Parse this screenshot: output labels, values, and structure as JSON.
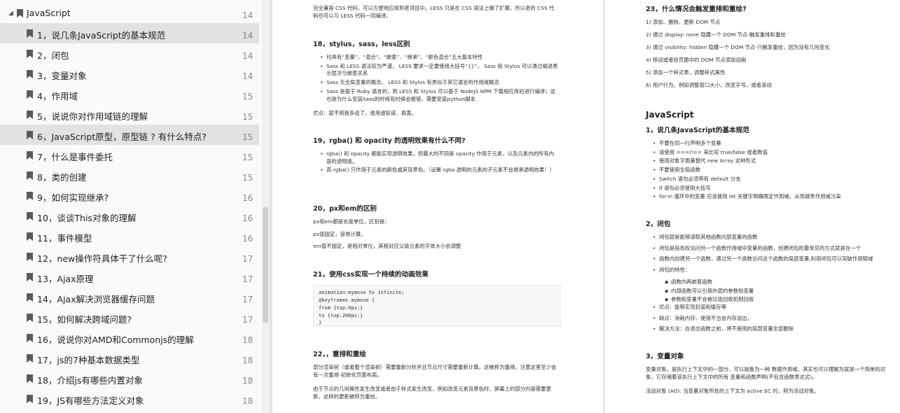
{
  "sidebar": {
    "title": "JavaScript",
    "title_page": "14",
    "items": [
      {
        "label": "1，说几条JavaScript的基本规范",
        "page": "14"
      },
      {
        "label": "2，闭包",
        "page": "14"
      },
      {
        "label": "3，变量对象",
        "page": "14"
      },
      {
        "label": "4，作用域",
        "page": "15"
      },
      {
        "label": "5，说说你对作用域链的理解",
        "page": "15"
      },
      {
        "label": "6，JavaScript原型，原型链 ? 有什么特点?",
        "page": "15"
      },
      {
        "label": "7，什么是事件委托",
        "page": "15"
      },
      {
        "label": "8，类的创建",
        "page": "15"
      },
      {
        "label": "9，如何实现继承?",
        "page": "16"
      },
      {
        "label": "10，谈谈This对象的理解",
        "page": "16"
      },
      {
        "label": "11，事件模型",
        "page": "16"
      },
      {
        "label": "12，new操作符具体干了什么呢?",
        "page": "17"
      },
      {
        "label": "13，Ajax原理",
        "page": "17"
      },
      {
        "label": "14，Ajax解决浏览器缓存问题",
        "page": "17"
      },
      {
        "label": "15，如何解决跨域问题?",
        "page": "17"
      },
      {
        "label": "16，说说你对AMD和Commonjs的理解",
        "page": "18"
      },
      {
        "label": "17，js的7种基本数据类型",
        "page": "18"
      },
      {
        "label": "18，介绍js有哪些内置对象",
        "page": "18"
      },
      {
        "label": "19，JS有哪些方法定义对象",
        "page": "18"
      }
    ]
  },
  "page1": {
    "intro_l1": "完全兼容 CSS 代码，可以方便地应用到老项目中。LESS 只是在 CSS 语法上做了扩展，所以老的 CSS 代",
    "intro_l2": "码也可以与 LESS 代码一同编译。",
    "s18_title": "18，stylus，sass，less区别",
    "s18_bullets": [
      "均具有“变量”、“混合”、“嵌套”、“继承”、“颜色混合”五大基本特性",
      "Sass 和 LESS 语法较为严谨， LESS 要求一定要使用大括号“{}”， Sass 和 Stylus 可以通过缩进表示层次与嵌套关系",
      "Sass 无全局变量的概念， LESS 和 Stylus 有类似于其它语言的作用域概念",
      "Sass 是基于 Ruby 语言的，而 LESS 和 Stylus 可以基于 NodeJS NPM 下载相应库后进行编译；这也是为什么安装Sass的时候有时候会报错，需要安装python脚本"
    ],
    "s18_note": "优点：就不用我多说了，谁用谁知道，真香。",
    "s19_title": "19，rgba() 和 opacity 的透明效果有什么不同?",
    "s19_bullets": [
      "rgba() 和 opacity 都能实现透明效果，但最大的不同是 opacity 作用于元素，以及元素内的所有内容的透明度。",
      "而 rgba() 只作用于元素的颜色或其背景色。（设置 rgba 透明的元素的子元素不会继承透明效果！）"
    ],
    "s20_title": "20，px和em的区别",
    "s20_lines": [
      "px和em都是长度单位，区别是：",
      "px值固定，容易计算。",
      "em值不固定，是相对单位，其相对应父级元素的字体大小会调整"
    ],
    "s21_title": "21，使用css实现一个持续的动画效果",
    "s21_code": "animation:mymove 5s infinite;\n@keyframes mymove {\nfrom {top:0px;}\nto {top:200px;}\n}",
    "s22_title": "22，，重排和重绘",
    "s22_p1": "部分渲染树（或者整个渲染树）需要重新分析并且节点尺寸需要重新计算。这被称为重排。注意这里至少会有一次重排-初始化页面布局。",
    "s22_p2": "由于节点的几何属性发生改变或者由于样式发生改变，例如改变元素背景色时，屏幕上的部分内容需要更新，这样的更新被称为重绘。"
  },
  "page2": {
    "s23_title": "23，什么情况会触发重排和重绘?",
    "s23_items": [
      "1) 添加、删除、更新 DOM 节点",
      "2) 通过 display: none 隐藏一个 DOM 节点-触发重排和重绘",
      "3) 通过 visibility: hidden 隐藏一个 DOM 节点-只触发重绘，因为没有几何变化",
      "4) 移动或者给页面中的 DOM 节点添加动画",
      "5) 添加一个样式表，调整样式属性",
      "6) 用户行为，例如调整窗口大小，改变字号，或者滚动"
    ],
    "js_title": "JavaScript",
    "js1_title": "1，说几条JavaScript的基本规范",
    "js1_bullets": [
      "不要在同一行声明多个变量",
      "请使用 ===/!== 来比较 true/false 或者数值",
      "使用对象字面量替代 new Array 这种形式",
      "不要使用全局函数",
      "Switch 语句必须带有 default 分支",
      "If 语句必须使用大括号",
      "for-in 循环中的变量 应该使用 let 关键字明确限定作用域，从而避免作用域污染"
    ],
    "js2_title": "2，闭包",
    "js2_bullets_a": [
      "闭包就是能够读取其他函数内部变量的函数",
      "闭包是指有权访问另一个函数作用域中变量的函数，创建闭包的最常见的方式就是在一个",
      "函数内创建另一个函数，通过另一个函数访问这个函数的局部变量,利用闭包可以突破作用链域",
      "闭包的特性："
    ],
    "js2_sub": [
      "函数内再嵌套函数",
      "内部函数可以引用外层的参数和变量",
      "参数和变量不会被垃圾回收机制回收"
    ],
    "js2_bullets_b": [
      "优点：能够实现封装和缓存等",
      "缺点：消耗内存、使用不当会内存溢出，",
      "解决方法：在退出函数之前，将不使用的局部变量全部删除"
    ],
    "js3_title": "3，变量对象",
    "js3_p1": "变量对象，是执行上下文中的一部分，可以抽象为一种 数据作用域，其实也可以理解为就是一个简单的对象，它存储着该执行上下文中的所有 变量和函数声明(不包含函数表达式)。",
    "js3_p2": "活动对象 (AO): 当变量对象所处的上下文为 active EC 时，称为活动对象。"
  }
}
